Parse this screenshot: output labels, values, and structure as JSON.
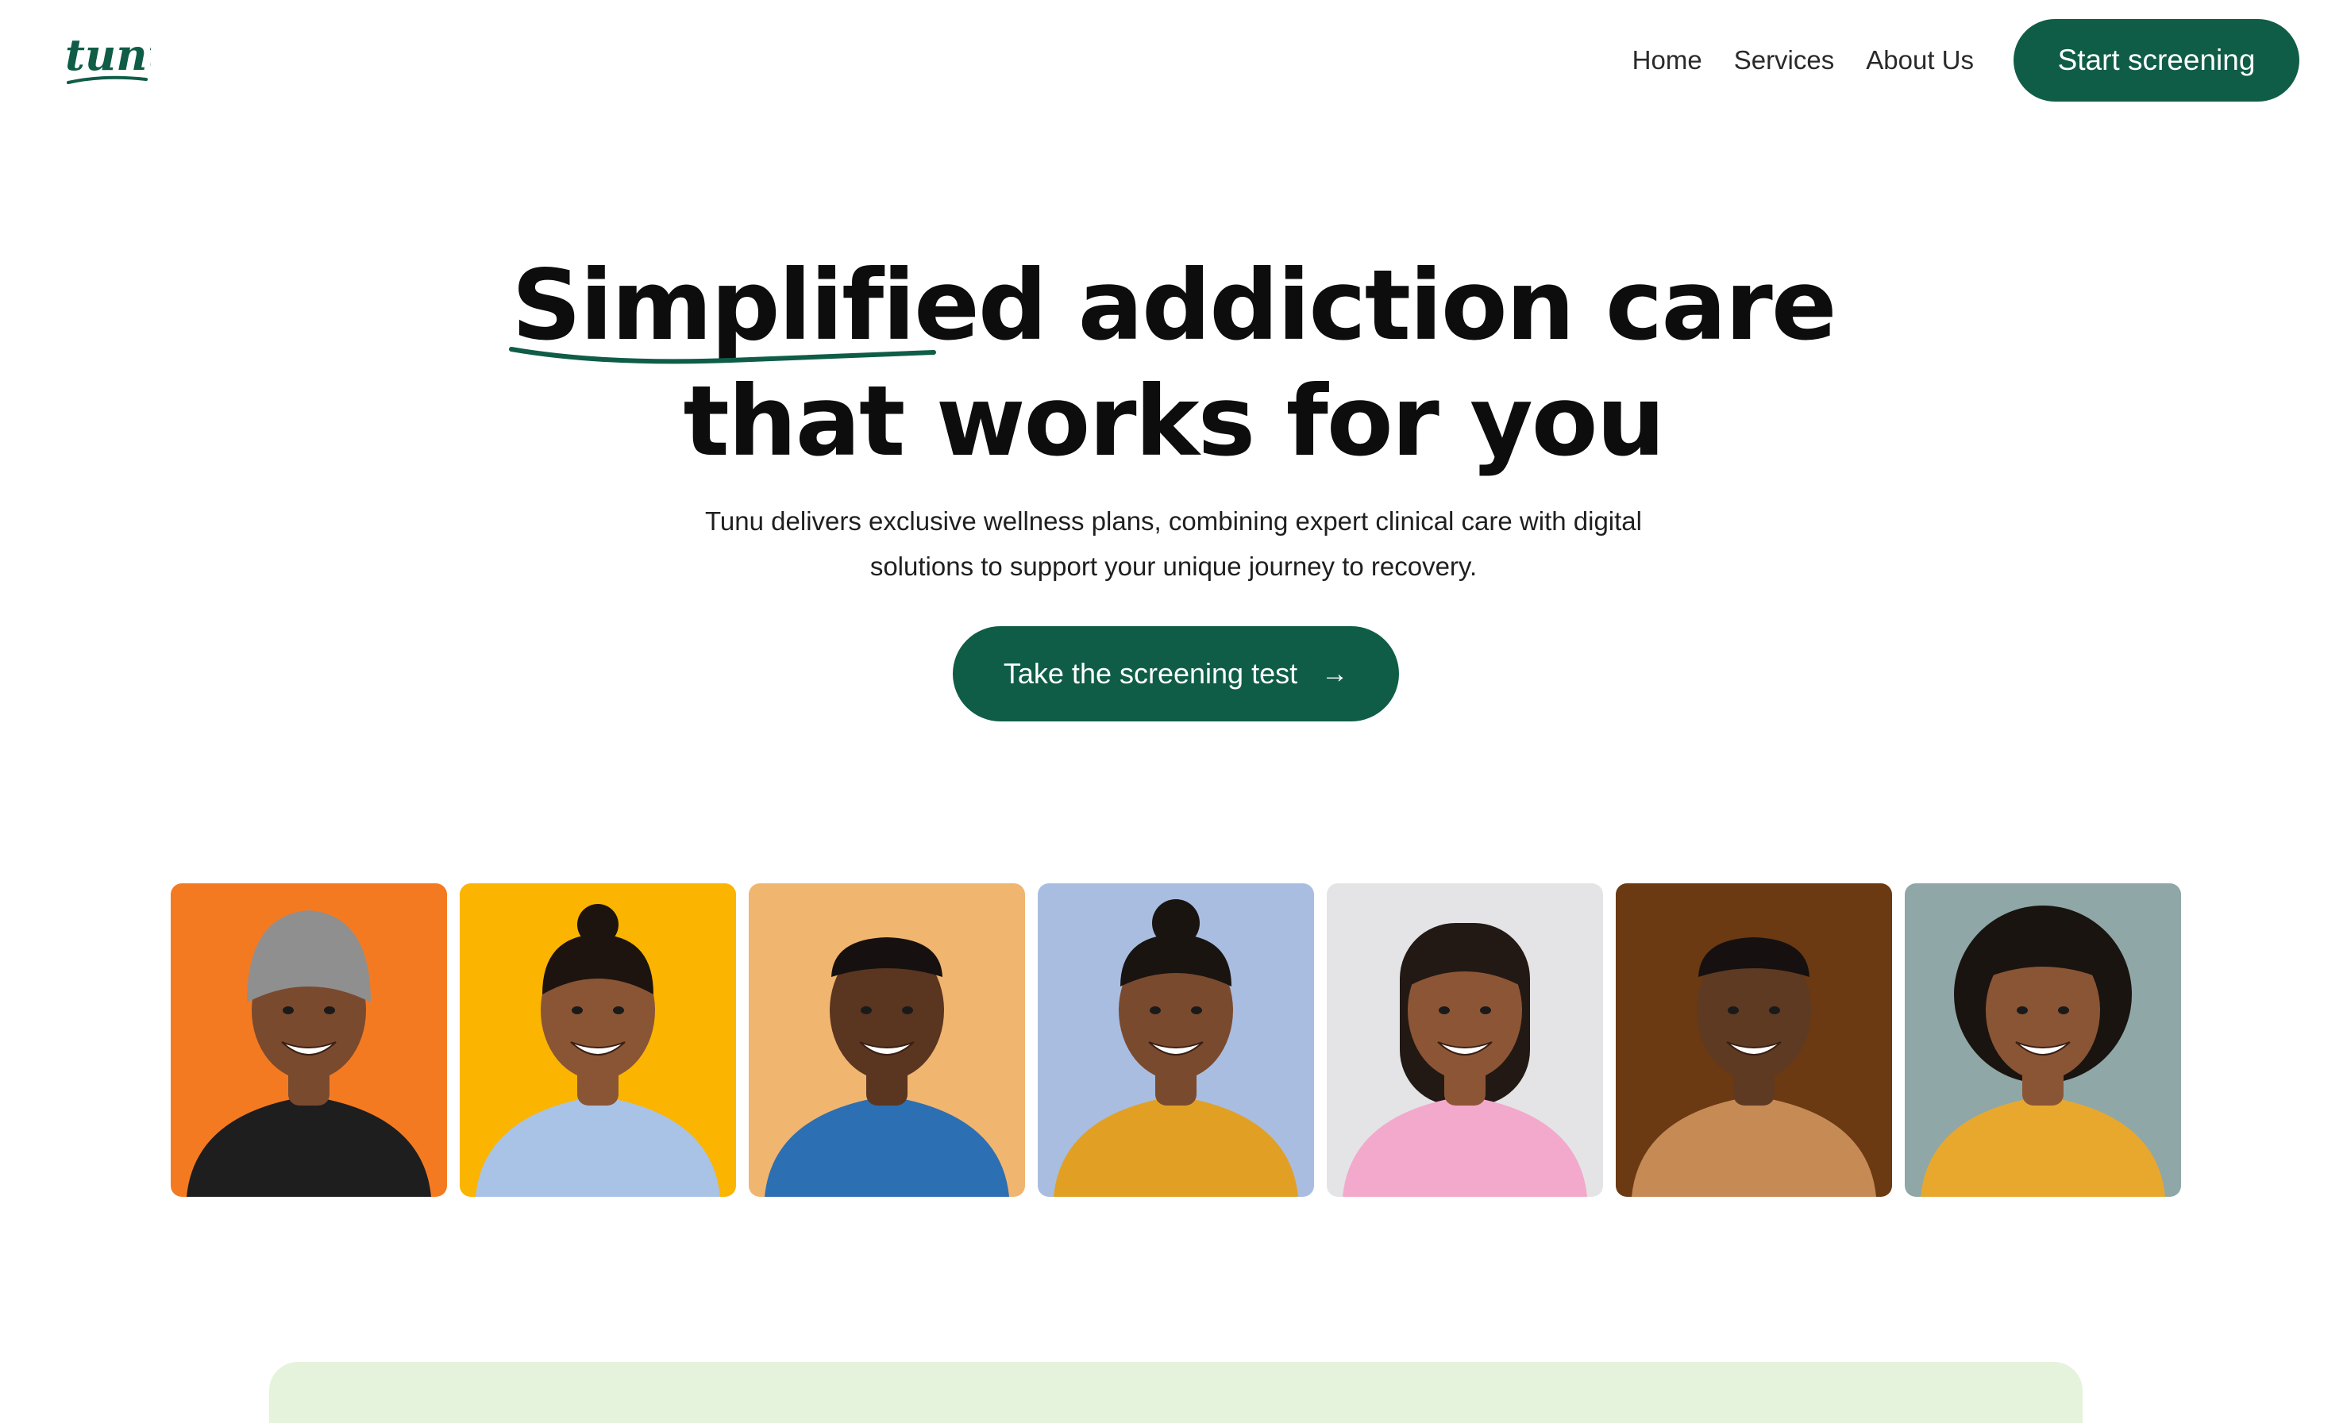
{
  "header": {
    "logo_text": "tunu",
    "nav": [
      {
        "label": "Home"
      },
      {
        "label": "Services"
      },
      {
        "label": "About Us"
      }
    ],
    "cta_label": "Start screening"
  },
  "hero": {
    "title_highlight": "Simplified",
    "title_rest_line1": " addiction care",
    "title_line2": "that works for you",
    "subtitle_line1": "Tunu delivers exclusive wellness plans, combining expert clinical care with digital",
    "subtitle_line2": "solutions to support your unique journey to recovery.",
    "cta_label": "Take the screening test",
    "cta_icon": "arrow-right-icon"
  },
  "gallery": {
    "portraits": [
      {
        "background": "#f47a22",
        "shirt": "#1e1e1e",
        "skin": "#7a4a2e",
        "hair": "beanie"
      },
      {
        "background": "#fbb400",
        "shirt": "#a9c3e6",
        "skin": "#8a5535",
        "hair": "bun"
      },
      {
        "background": "#f0b56f",
        "shirt": "#2c6fb3",
        "skin": "#5a3520",
        "hair": "short"
      },
      {
        "background": "#a9bde0",
        "shirt": "#e1a024",
        "skin": "#7a4a2e",
        "hair": "braids"
      },
      {
        "background": "#e4e4e6",
        "shirt": "#f3a9cc",
        "skin": "#8c5636",
        "hair": "bob"
      },
      {
        "background": "#6b3912",
        "shirt": "#c68a55",
        "skin": "#5e3a22",
        "hair": "short"
      },
      {
        "background": "#8fa7a7",
        "shirt": "#e8a82e",
        "skin": "#8a5535",
        "hair": "curly"
      }
    ]
  },
  "colors": {
    "brand_green": "#0f5d47",
    "panel_green": "#e6f3dc"
  }
}
